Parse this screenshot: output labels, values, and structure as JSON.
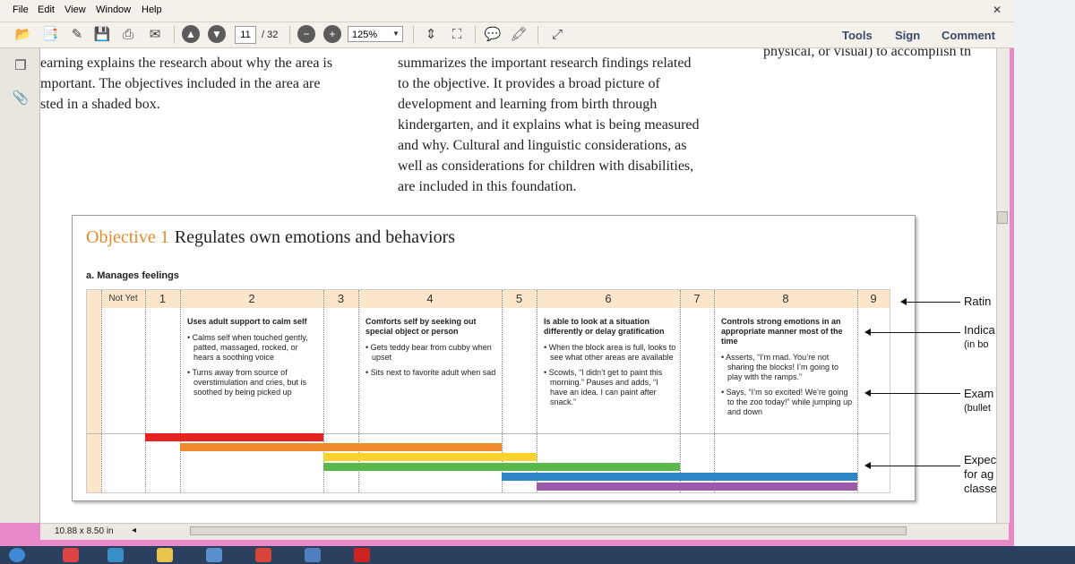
{
  "menubar": {
    "items": [
      "File",
      "Edit",
      "View",
      "Window",
      "Help"
    ]
  },
  "toolbar": {
    "page_current": "11",
    "page_total": "/ 32",
    "zoom": "125%",
    "links": [
      "Tools",
      "Sign",
      "Comment"
    ]
  },
  "document": {
    "col1_lines": [
      "earning explains the research about why the area is",
      "mportant. The objectives included in the area are",
      "sted in a shaded box."
    ],
    "col2_lines": [
      "summarizes the important research findings related",
      "to the objective. It provides a broad picture of",
      "development and learning from birth through",
      "kindergarten, and it explains what is being measured",
      "and why. Cultural and linguistic considerations, as",
      "well as considerations for children with disabilities,",
      "are included in this foundation."
    ],
    "col3_line": "physical, or visual) to accomplish th"
  },
  "objective": {
    "number": "Objective 1",
    "title": "Regulates own emotions and behaviors",
    "subtitle": "a. Manages feelings"
  },
  "rating_header": [
    "Not Yet",
    "1",
    "2",
    "3",
    "4",
    "5",
    "6",
    "7",
    "8",
    "9"
  ],
  "indicators": [
    {
      "heading": "Uses adult support to calm self",
      "bullets": [
        "• Calms self when touched gently, patted, massaged, rocked, or hears a soothing voice",
        "• Turns away from source of overstimulation and cries, but is soothed by being picked up"
      ]
    },
    {
      "heading": "Comforts self by seeking out special object or person",
      "bullets": [
        "• Gets teddy bear from cubby when upset",
        "• Sits next to favorite adult when sad"
      ]
    },
    {
      "heading": "Is able to look at a situation differently or delay gratification",
      "bullets": [
        "• When the block area is full, looks to see what other areas are available",
        "• Scowls, “I didn’t get to paint this morning.” Pauses and adds, “I have an idea. I can paint after snack.”"
      ]
    },
    {
      "heading": "Controls strong emotions in an appropriate manner most of the time",
      "bullets": [
        "• Asserts, “I’m mad. You’re not sharing the blocks! I’m going to play with the ramps.”",
        "• Says, “I’m so excited! We’re going to the zoo today!” while jumping up and down"
      ]
    }
  ],
  "age_bands": {
    "colors": [
      "#e52421",
      "#f1892d",
      "#fbd22c",
      "#5cb84a",
      "#2f86c7",
      "#9b59a8"
    ]
  },
  "callouts": {
    "rating": "Ratin",
    "indicator": "Indica",
    "indicator_sub": "(in bo",
    "examples": "Exam",
    "examples_sub": "(bullet",
    "expected_1": "Expec",
    "expected_2": "for ag",
    "expected_3": "classe"
  },
  "status": {
    "page_size": "10.88 x 8.50 in"
  }
}
